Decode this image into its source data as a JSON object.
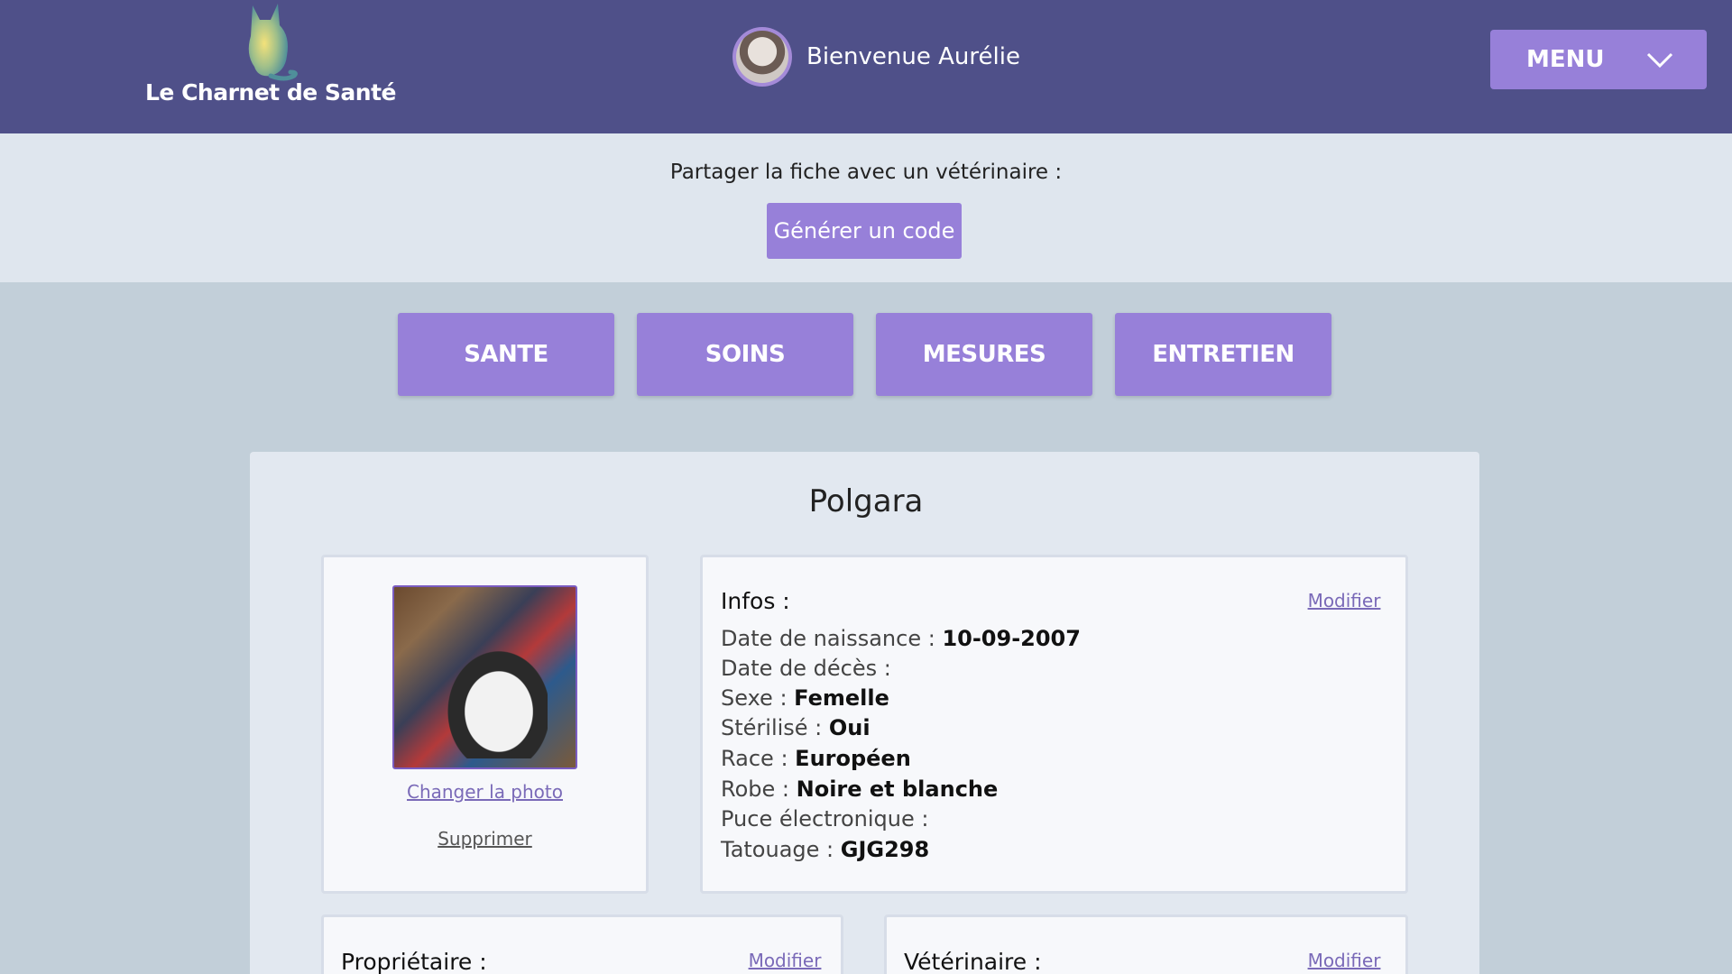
{
  "header": {
    "logo_text": "Le Charnet de Santé",
    "welcome": "Bienvenue Aurélie",
    "menu_label": "MENU"
  },
  "share": {
    "label": "Partager la fiche avec un vétérinaire :",
    "button": "Générer un code"
  },
  "tabs": [
    {
      "label": "SANTE"
    },
    {
      "label": "SOINS"
    },
    {
      "label": "MESURES"
    },
    {
      "label": "ENTRETIEN"
    }
  ],
  "pet": {
    "name": "Polgara",
    "change_photo": "Changer la photo",
    "delete": "Supprimer"
  },
  "infos": {
    "title": "Infos :",
    "edit": "Modifier",
    "fields": [
      {
        "label": "Date de naissance : ",
        "value": "10-09-2007"
      },
      {
        "label": "Date de décès : ",
        "value": ""
      },
      {
        "label": "Sexe : ",
        "value": "Femelle"
      },
      {
        "label": "Stérilisé : ",
        "value": "Oui"
      },
      {
        "label": "Race : ",
        "value": "Européen"
      },
      {
        "label": "Robe : ",
        "value": "Noire et blanche"
      },
      {
        "label": "Puce électronique : ",
        "value": ""
      },
      {
        "label": "Tatouage : ",
        "value": "GJG298"
      }
    ]
  },
  "owner": {
    "title": "Propriétaire :",
    "edit": "Modifier"
  },
  "vet": {
    "title": "Vétérinaire :",
    "edit": "Modifier"
  },
  "colors": {
    "header_bg": "#4f5089",
    "accent": "#9780d9",
    "page_bg": "#c2cfd9"
  }
}
